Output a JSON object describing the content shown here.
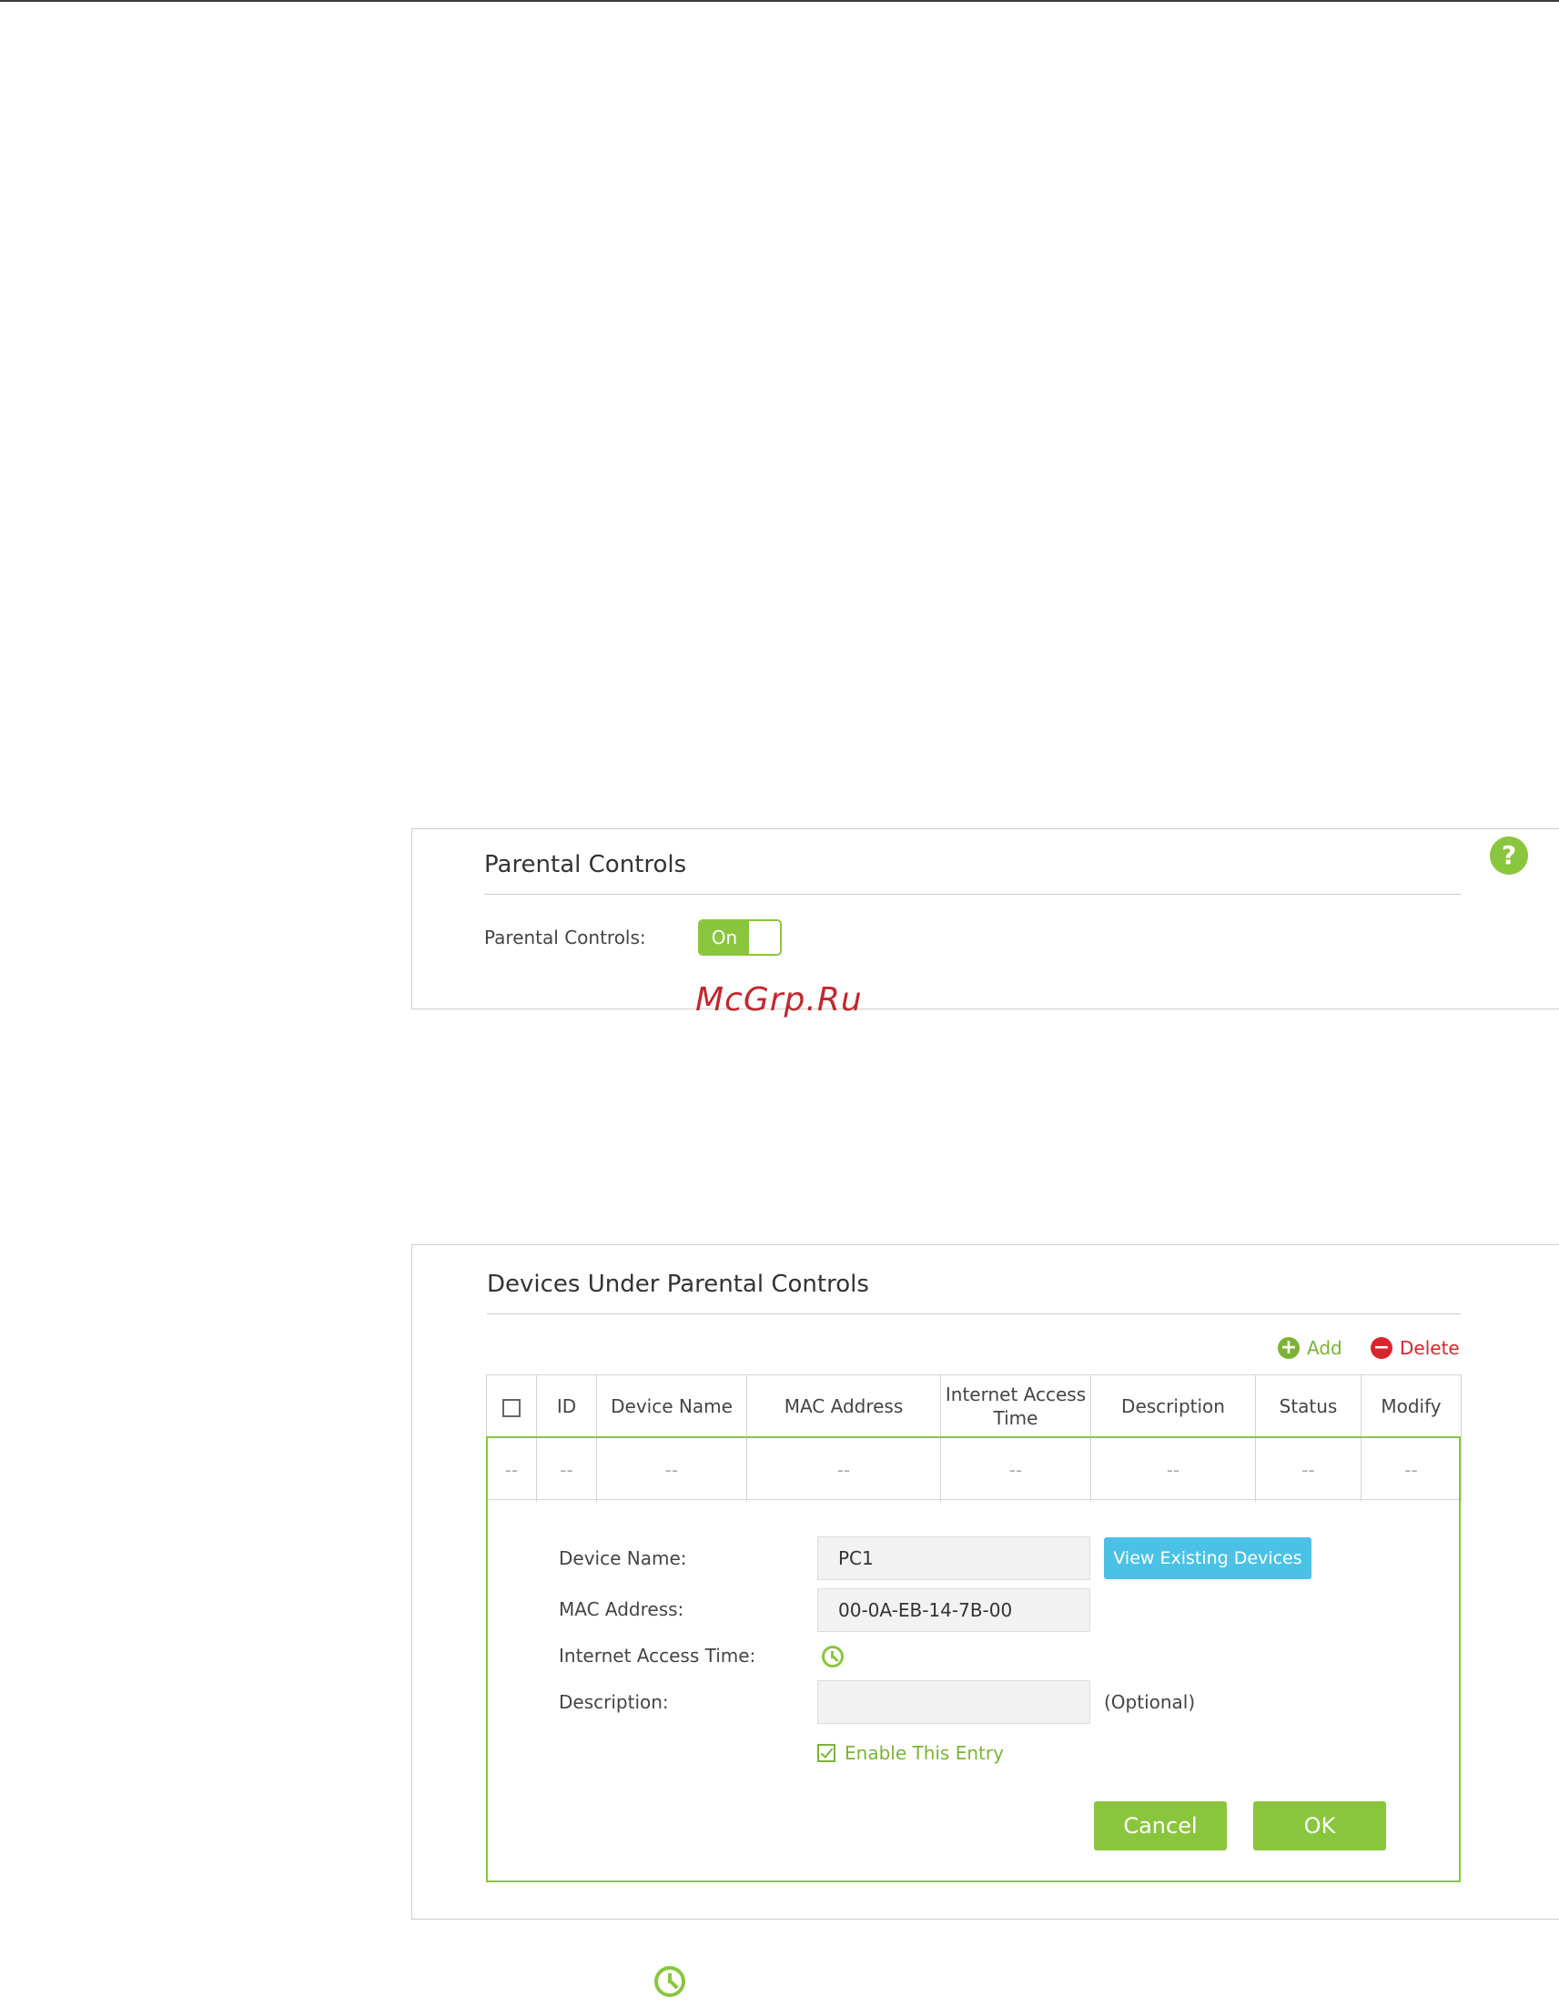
{
  "watermark": "McGrp.Ru",
  "parental_controls_panel": {
    "title": "Parental Controls",
    "field_label": "Parental Controls:",
    "toggle_label": "On",
    "help_label": "?"
  },
  "devices_panel": {
    "title": "Devices Under Parental Controls",
    "add_label": "Add",
    "delete_label": "Delete",
    "columns": [
      "ID",
      "Device Name",
      "MAC Address",
      "Internet Access Time",
      "Description",
      "Status",
      "Modify"
    ],
    "empty_row": [
      "--",
      "--",
      "--",
      "--",
      "--",
      "--",
      "--",
      "--"
    ],
    "form": {
      "device_name_label": "Device Name:",
      "device_name_value": "PC1",
      "view_devices_label": "View Existing Devices",
      "mac_label": "MAC Address:",
      "mac_value": "00-0A-EB-14-7B-00",
      "access_time_label": "Internet Access Time:",
      "description_label": "Description:",
      "description_value": "",
      "optional_label": "(Optional)",
      "enable_label": "Enable This Entry",
      "cancel_label": "Cancel",
      "ok_label": "OK"
    }
  },
  "icons": {
    "help": "question-circle-icon",
    "add": "plus-circle-icon",
    "delete": "minus-circle-icon",
    "clock": "clock-icon"
  },
  "colors": {
    "accent_green": "#8ac53e",
    "link_green": "#7bb334",
    "delete_red": "#d9252d",
    "info_blue": "#4cc1e6",
    "watermark_red": "#c0282e"
  }
}
